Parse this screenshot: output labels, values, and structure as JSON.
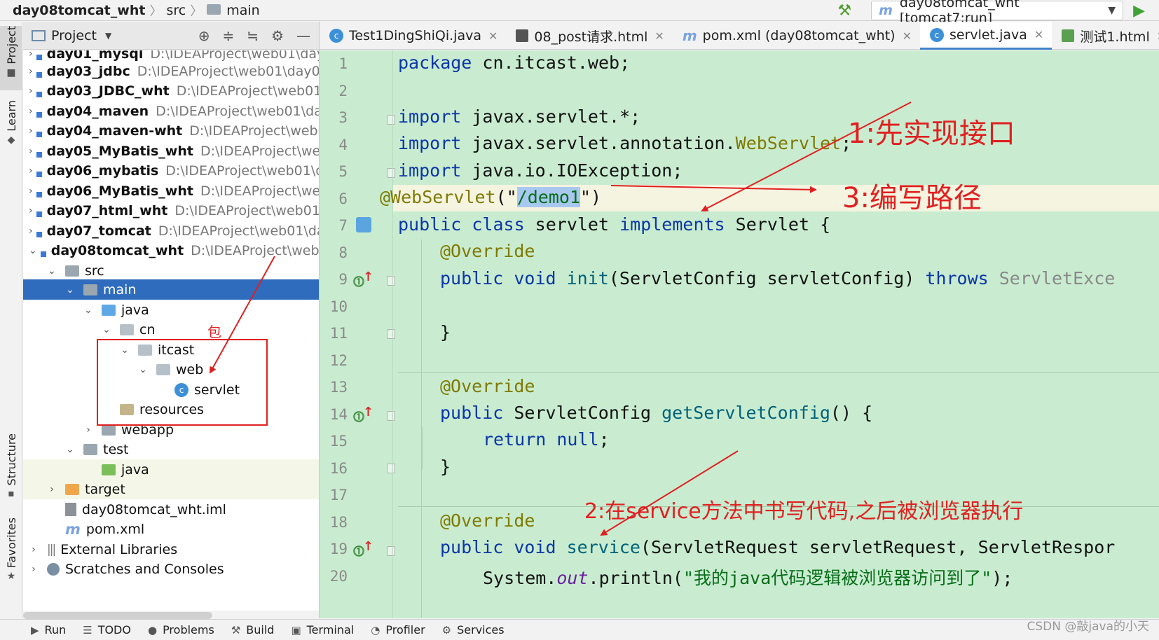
{
  "navbar": {
    "project": "day08tomcat_wht",
    "crumb_src": "src",
    "crumb_main": "main",
    "run_config": "day08tomcat_wht [tomcat7:run]"
  },
  "left_stripe": {
    "project": "Project",
    "learn": "Learn",
    "structure": "Structure",
    "favorites": "Favorites"
  },
  "project_panel": {
    "title": "Project"
  },
  "tree": [
    {
      "label": "day01_mysql",
      "path": "D:\\IDEAProject\\web01\\day",
      "bold": true
    },
    {
      "label": "day03_jdbc",
      "path": "D:\\IDEAProject\\web01\\day03",
      "bold": true
    },
    {
      "label": "day03_JDBC_wht",
      "path": "D:\\IDEAProject\\web01\\",
      "bold": true
    },
    {
      "label": "day04_maven",
      "path": "D:\\IDEAProject\\web01\\day",
      "bold": true
    },
    {
      "label": "day04_maven-wht",
      "path": "D:\\IDEAProject\\web0",
      "bold": true
    },
    {
      "label": "day05_MyBatis_wht",
      "path": "D:\\IDEAProject\\web",
      "bold": true
    },
    {
      "label": "day06_mybatis",
      "path": "D:\\IDEAProject\\web01\\da",
      "bold": true
    },
    {
      "label": "day06_MyBatis_wht",
      "path": "D:\\IDEAProject\\web",
      "bold": true
    },
    {
      "label": "day07_html_wht",
      "path": "D:\\IDEAProject\\web01\\",
      "bold": true
    },
    {
      "label": "day07_tomcat",
      "path": "D:\\IDEAProject\\web01\\day",
      "bold": true
    },
    {
      "label": "day08tomcat_wht",
      "path": "D:\\IDEAProject\\web01",
      "bold": true
    },
    {
      "label": "src"
    },
    {
      "label": "main"
    },
    {
      "label": "java"
    },
    {
      "label": "cn"
    },
    {
      "label": "itcast"
    },
    {
      "label": "web"
    },
    {
      "label": "servlet"
    },
    {
      "label": "resources"
    },
    {
      "label": "webapp"
    },
    {
      "label": "test"
    },
    {
      "label": "java"
    },
    {
      "label": "target"
    },
    {
      "label": "day08tomcat_wht.iml"
    },
    {
      "label": "pom.xml"
    },
    {
      "label": "External Libraries"
    },
    {
      "label": "Scratches and Consoles"
    }
  ],
  "tabs": [
    {
      "label": "Test1DingShiQi.java",
      "icon": "class-icon"
    },
    {
      "label": "08_post请求.html",
      "icon": "html-icon"
    },
    {
      "label": "pom.xml (day08tomcat_wht)",
      "icon": "maven-icon"
    },
    {
      "label": "servlet.java",
      "icon": "class-icon",
      "active": true
    },
    {
      "label": "测试1.html",
      "icon": "html-icon"
    }
  ],
  "line_numbers": [
    "1",
    "2",
    "3",
    "4",
    "5",
    "6",
    "7",
    "8",
    "9",
    "10",
    "11",
    "12",
    "13",
    "14",
    "15",
    "16",
    "17",
    "18",
    "19",
    "20"
  ],
  "code": {
    "l1_kw": "package",
    "l1_rest": " cn.itcast.web;",
    "l3_kw": "import",
    "l3_rest": " javax.servlet.*;",
    "l4_kw": "import",
    "l4_rest": " javax.servlet.annotation.",
    "l4_cls": "WebServlet",
    "l4_end": ";",
    "l5_kw": "import",
    "l5_rest": " java.io.IOException;",
    "l6_ann": "@WebServlet",
    "l6_open": "(\"",
    "l6_sel": "/demo1",
    "l6_close": "\")",
    "l7_kw1": "public class",
    "l7_name": " servlet ",
    "l7_kw2": "implements",
    "l7_rest": " Servlet {",
    "l8_ann": "@Override",
    "l9_kw": "public void",
    "l9_fn": " init",
    "l9_args": "(ServletConfig servletConfig) ",
    "l9_throws": "throws",
    "l9_exc": " ServletExce",
    "l11_brace": "}",
    "l13_ann": "@Override",
    "l14_kw": "public",
    "l14_type": " ServletConfig ",
    "l14_fn": "getServletConfig",
    "l14_rest": "() {",
    "l15_kw": "return null",
    "l15_rest": ";",
    "l16_brace": "}",
    "l18_ann": "@Override",
    "l19_kw": "public void",
    "l19_fn": " service",
    "l19_args": "(ServletRequest servletRequest, ServletRespor",
    "l20_a": "System.",
    "l20_fld": "out",
    "l20_b": ".println(",
    "l20_str": "\"我的java代码逻辑被浏览器访问到了\"",
    "l20_c": ");"
  },
  "annotations": {
    "a1": "1:先实现接口",
    "a2": "2:在service方法中书写代码,之后被浏览器执行",
    "a3": "3:编写路径",
    "pkg": "包"
  },
  "bottom_bar": [
    "Run",
    "TODO",
    "Problems",
    "Build",
    "Terminal",
    "Profiler",
    "Services"
  ],
  "watermark": "CSDN @敲java的小天",
  "colors": {
    "annotation": "#e02020",
    "editor_bg": "#c9ecd0",
    "selection": "#2f6cbd"
  }
}
